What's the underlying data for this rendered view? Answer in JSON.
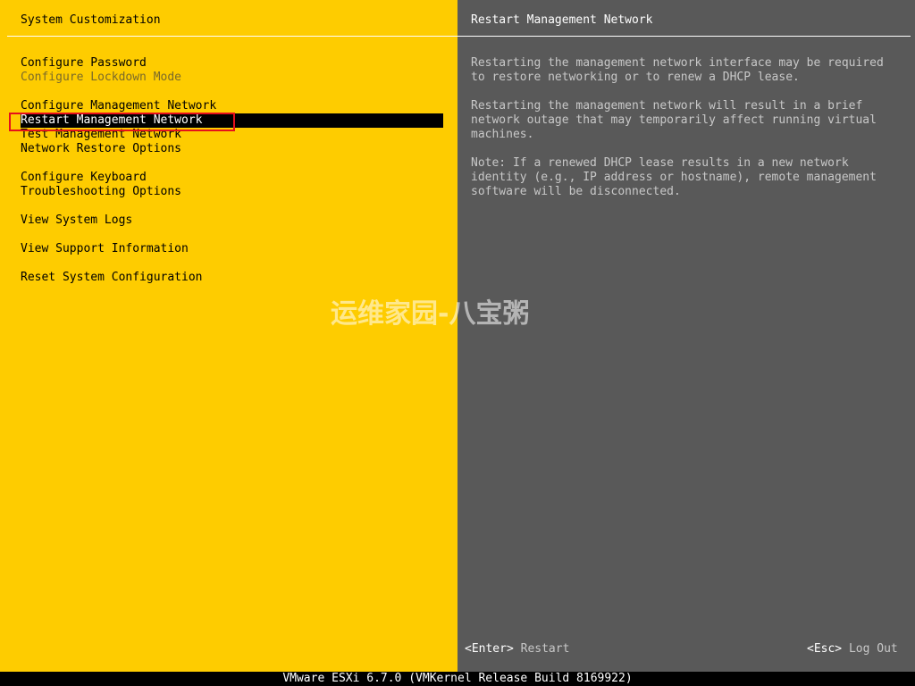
{
  "left_panel": {
    "title": "System Customization",
    "menu": [
      {
        "label": "Configure Password",
        "state": "normal"
      },
      {
        "label": "Configure Lockdown Mode",
        "state": "disabled"
      },
      {
        "label": "Configure Management Network",
        "state": "normal"
      },
      {
        "label": "Restart Management Network",
        "state": "selected"
      },
      {
        "label": "Test Management Network",
        "state": "normal"
      },
      {
        "label": "Network Restore Options",
        "state": "normal"
      },
      {
        "label": "Configure Keyboard",
        "state": "normal"
      },
      {
        "label": "Troubleshooting Options",
        "state": "normal"
      },
      {
        "label": "View System Logs",
        "state": "normal"
      },
      {
        "label": "View Support Information",
        "state": "normal"
      },
      {
        "label": "Reset System Configuration",
        "state": "normal"
      }
    ]
  },
  "right_panel": {
    "title": "Restart Management Network",
    "paragraphs": [
      "Restarting the management network interface may be required\nto restore networking or to renew a DHCP lease.",
      "Restarting the management network will result in a brief\nnetwork outage that may temporarily affect running virtual\nmachines.",
      "Note: If a renewed DHCP lease results in a new network\nidentity (e.g., IP address or hostname), remote management\nsoftware will be disconnected."
    ]
  },
  "footer": {
    "enter_key": "<Enter>",
    "enter_action": "Restart",
    "esc_key": "<Esc>",
    "esc_action": "Log Out"
  },
  "status_bar": "VMware ESXi 6.7.0 (VMKernel Release Build 8169922)",
  "watermark": "运维家园-八宝粥",
  "colors": {
    "left_background": "#fecc00",
    "right_background": "#595959",
    "highlight_border": "#e6101b"
  }
}
